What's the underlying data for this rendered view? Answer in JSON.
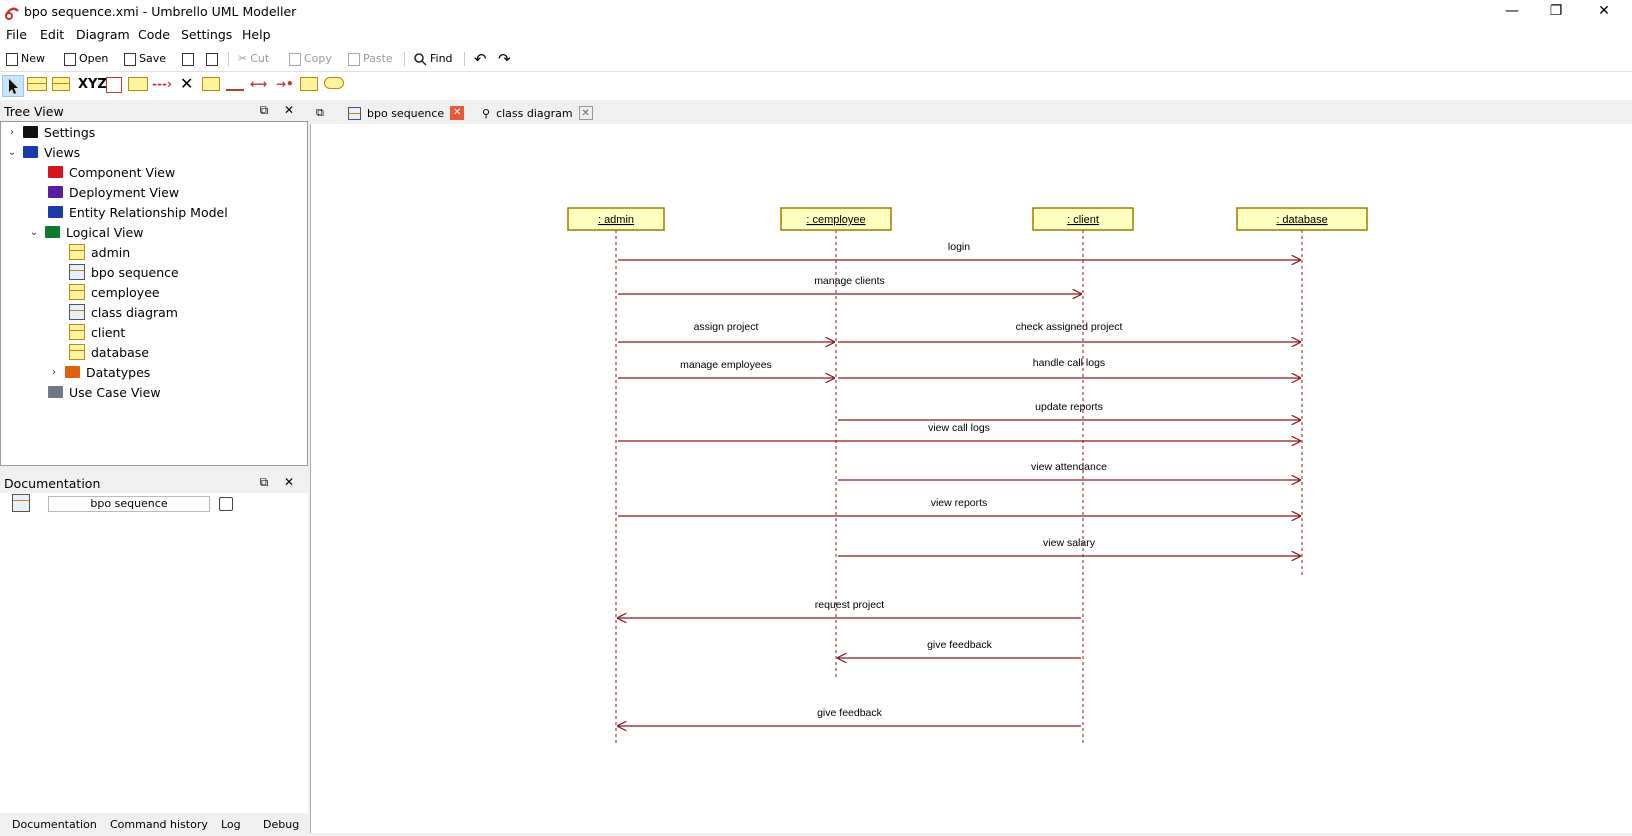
{
  "window": {
    "title": "bpo sequence.xmi  - Umbrello UML Modeller",
    "minimize": "—",
    "restore": "❐",
    "close": "✕"
  },
  "menu": [
    "File",
    "Edit",
    "Diagram",
    "Code",
    "Settings",
    "Help"
  ],
  "toolbar": {
    "new": "New",
    "open": "Open",
    "save": "Save",
    "cut": "Cut",
    "copy": "Copy",
    "paste": "Paste",
    "find": "Find"
  },
  "tools2": {
    "xyz": "XYZ"
  },
  "tree_view": {
    "title": "Tree View",
    "items": [
      {
        "label": "Settings",
        "icon": "settings-folder-icon"
      },
      {
        "label": "Views",
        "icon": "views-folder-icon"
      },
      {
        "label": "Component View",
        "icon": "component-folder-icon"
      },
      {
        "label": "Deployment View",
        "icon": "deployment-folder-icon"
      },
      {
        "label": "Entity Relationship Model",
        "icon": "er-folder-icon"
      },
      {
        "label": "Logical View",
        "icon": "logical-folder-icon"
      },
      {
        "label": "admin",
        "icon": "class-icon"
      },
      {
        "label": "bpo sequence",
        "icon": "sequence-diagram-icon"
      },
      {
        "label": "cemployee",
        "icon": "class-icon"
      },
      {
        "label": "class diagram",
        "icon": "class-diagram-icon"
      },
      {
        "label": "client",
        "icon": "class-icon"
      },
      {
        "label": "database",
        "icon": "class-icon"
      },
      {
        "label": "Datatypes",
        "icon": "datatypes-folder-icon"
      },
      {
        "label": "Use Case View",
        "icon": "usecase-folder-icon"
      }
    ]
  },
  "documentation": {
    "title": "Documentation",
    "field": "bpo sequence"
  },
  "bottom_tabs": [
    "Documentation",
    "Command history",
    "Log",
    "Debug"
  ],
  "tabs": [
    {
      "label": "bpo sequence",
      "active": true
    },
    {
      "label": "class diagram",
      "active": false
    }
  ],
  "diagram": {
    "lifelines": [
      ": admin",
      ": cemployee",
      ": client",
      ": database"
    ],
    "messages": [
      {
        "label": "login",
        "from": 0,
        "to": 3
      },
      {
        "label": "manage clients",
        "from": 0,
        "to": 2
      },
      {
        "label": "assign project",
        "from": 0,
        "to": 1
      },
      {
        "label": "check assigned project",
        "from": 1,
        "to": 3
      },
      {
        "label": "manage employees",
        "from": 0,
        "to": 1
      },
      {
        "label": "handle call logs",
        "from": 1,
        "to": 3
      },
      {
        "label": "update reports",
        "from": 1,
        "to": 3
      },
      {
        "label": "view call logs",
        "from": 0,
        "to": 3
      },
      {
        "label": "view attendance",
        "from": 1,
        "to": 3
      },
      {
        "label": "view reports",
        "from": 0,
        "to": 3
      },
      {
        "label": "view salary",
        "from": 1,
        "to": 3
      },
      {
        "label": "request project",
        "from": 2,
        "to": 0
      },
      {
        "label": "give feedback",
        "from": 2,
        "to": 1
      },
      {
        "label": "give feedback",
        "from": 2,
        "to": 0
      }
    ],
    "colors": {
      "line": "#8b1a1a",
      "lifeline_fill": "#ffffc0",
      "lifeline_border": "#a07800"
    }
  }
}
